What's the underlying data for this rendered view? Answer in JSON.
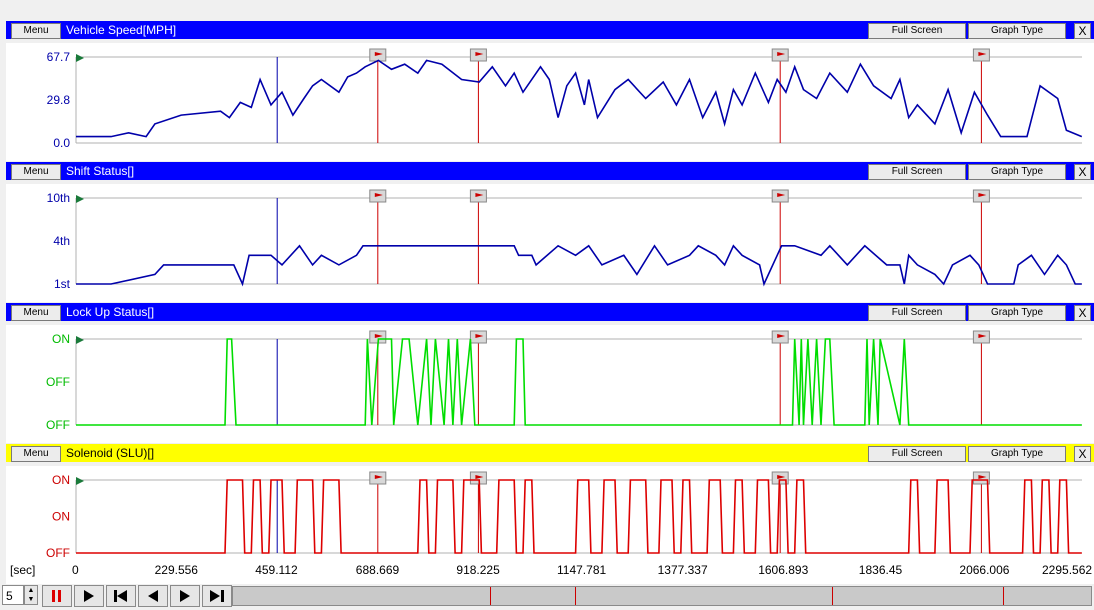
{
  "panels": [
    {
      "menu_label": "Menu",
      "title": "Vehicle Speed[MPH]",
      "full_screen_label": "Full Screen",
      "graph_type_label": "Graph Type",
      "close_label": "X",
      "bar_color": "#0000ff",
      "title_color": "#ffffff",
      "y_labels": [
        "67.7",
        "29.8",
        "0.0"
      ]
    },
    {
      "menu_label": "Menu",
      "title": "Shift Status[]",
      "full_screen_label": "Full Screen",
      "graph_type_label": "Graph Type",
      "close_label": "X",
      "bar_color": "#0000ff",
      "title_color": "#ffffff",
      "y_labels": [
        "10th",
        "4th",
        "1st"
      ]
    },
    {
      "menu_label": "Menu",
      "title": "Lock Up Status[]",
      "full_screen_label": "Full Screen",
      "graph_type_label": "Graph Type",
      "close_label": "X",
      "bar_color": "#0000ff",
      "title_color": "#ffffff",
      "y_labels": [
        "ON",
        "OFF",
        "OFF"
      ]
    },
    {
      "menu_label": "Menu",
      "title": "Solenoid (SLU)[]",
      "full_screen_label": "Full Screen",
      "graph_type_label": "Graph Type",
      "close_label": "X",
      "bar_color": "#ffff00",
      "title_color": "#000000",
      "y_labels": [
        "ON",
        "ON",
        "OFF"
      ]
    }
  ],
  "x_axis": {
    "unit_label": "[sec]",
    "ticks": [
      "0",
      "229.556",
      "459.112",
      "688.669",
      "918.225",
      "1147.781",
      "1377.337",
      "1606.893",
      "1836.45",
      "2066.006",
      "2295.562"
    ]
  },
  "controls": {
    "step_value": "5",
    "buttons": [
      "stop-icon",
      "play-icon",
      "skip-start-icon",
      "step-back-icon",
      "step-forward-icon",
      "skip-end-icon"
    ]
  },
  "chart_data": [
    {
      "type": "line",
      "title": "Vehicle Speed[MPH]",
      "color": "#0000aa",
      "xlim": [
        0,
        2295.562
      ],
      "ylim": [
        0,
        67.7
      ],
      "x": [
        0,
        80,
        120,
        160,
        180,
        240,
        330,
        350,
        375,
        400,
        420,
        445,
        470,
        495,
        520,
        540,
        560,
        600,
        620,
        640,
        660,
        690,
        720,
        750,
        780,
        800,
        835,
        880,
        920,
        950,
        980,
        1000,
        1020,
        1060,
        1080,
        1100,
        1120,
        1140,
        1160,
        1170,
        1190,
        1230,
        1260,
        1300,
        1340,
        1370,
        1400,
        1430,
        1460,
        1480,
        1500,
        1520,
        1550,
        1580,
        1600,
        1620,
        1640,
        1660,
        1690,
        1720,
        1760,
        1790,
        1820,
        1860,
        1880,
        1900,
        1920,
        1960,
        1990,
        2020,
        2050,
        2080,
        2110,
        2140,
        2170,
        2200,
        2240,
        2260,
        2295
      ],
      "y": [
        5,
        5,
        8,
        5,
        15,
        22,
        25,
        20,
        32,
        28,
        50,
        30,
        40,
        22,
        35,
        45,
        50,
        40,
        52,
        55,
        60,
        65,
        58,
        62,
        55,
        65,
        62,
        50,
        48,
        60,
        45,
        55,
        40,
        60,
        50,
        20,
        45,
        55,
        30,
        50,
        20,
        42,
        50,
        35,
        48,
        30,
        50,
        20,
        40,
        15,
        42,
        30,
        55,
        32,
        50,
        40,
        60,
        42,
        35,
        55,
        40,
        62,
        45,
        35,
        50,
        20,
        30,
        15,
        42,
        8,
        40,
        22,
        5,
        5,
        5,
        45,
        35,
        10,
        5
      ]
    },
    {
      "type": "line",
      "title": "Shift Status[]",
      "color": "#0000aa",
      "xlim": [
        0,
        2295.562
      ],
      "ylim": [
        1,
        10
      ],
      "x": [
        0,
        80,
        180,
        200,
        360,
        380,
        395,
        445,
        470,
        510,
        540,
        560,
        600,
        640,
        655,
        690,
        780,
        1000,
        1010,
        1040,
        1050,
        1100,
        1140,
        1170,
        1200,
        1250,
        1280,
        1320,
        1350,
        1400,
        1420,
        1460,
        1480,
        1500,
        1520,
        1560,
        1570,
        1600,
        1610,
        1620,
        1640,
        1700,
        1720,
        1740,
        1760,
        1800,
        1850,
        1880,
        1890,
        1900,
        1920,
        1960,
        1980,
        2000,
        2040,
        2060,
        2080,
        2120,
        2140,
        2150,
        2180,
        2210,
        2240,
        2260,
        2280,
        2295
      ],
      "y": [
        1,
        1,
        2,
        3,
        3,
        1,
        4,
        4,
        3,
        5,
        3,
        4,
        3,
        4,
        5,
        5,
        5,
        5,
        4,
        4,
        3,
        5,
        4,
        5,
        3,
        4,
        2,
        5,
        3,
        4,
        5,
        4,
        3,
        5,
        4,
        3,
        1,
        4,
        5,
        5,
        5,
        4,
        5,
        4,
        3,
        5,
        3,
        3,
        1,
        4,
        3,
        2,
        1,
        3,
        4,
        3,
        1,
        1,
        1,
        3,
        4,
        2,
        4,
        3,
        1,
        1
      ]
    },
    {
      "type": "line",
      "title": "Lock Up Status[]",
      "color": "#00dd00",
      "xlim": [
        0,
        2295.562
      ],
      "ylim": [
        0,
        1
      ],
      "x": [
        0,
        340,
        345,
        355,
        365,
        375,
        660,
        665,
        675,
        690,
        700,
        720,
        725,
        745,
        760,
        780,
        800,
        810,
        820,
        840,
        850,
        860,
        870,
        880,
        900,
        910,
        1000,
        1005,
        1020,
        1025,
        1030,
        1635,
        1640,
        1650,
        1655,
        1660,
        1670,
        1680,
        1690,
        1700,
        1710,
        1720,
        1730,
        1800,
        1805,
        1810,
        1820,
        1830,
        1835,
        1880,
        1890,
        1900,
        1905,
        2295
      ],
      "y": [
        0,
        0,
        1,
        1,
        0,
        0,
        0,
        1,
        0,
        1,
        1,
        1,
        0,
        1,
        1,
        0,
        1,
        0,
        1,
        0,
        1,
        0,
        1,
        0,
        1,
        0,
        0,
        1,
        1,
        0,
        0,
        0,
        1,
        0,
        1,
        0,
        1,
        0,
        1,
        0,
        1,
        1,
        0,
        0,
        1,
        0,
        1,
        0,
        1,
        0,
        1,
        0,
        0,
        0
      ]
    },
    {
      "type": "line",
      "title": "Solenoid (SLU)[]",
      "color": "#dd0000",
      "xlim": [
        0,
        2295.562
      ],
      "ylim": [
        0,
        1
      ],
      "x": [
        0,
        340,
        345,
        380,
        385,
        400,
        405,
        420,
        425,
        440,
        445,
        470,
        475,
        500,
        505,
        540,
        545,
        560,
        565,
        600,
        605,
        780,
        785,
        800,
        805,
        820,
        825,
        860,
        865,
        880,
        885,
        920,
        925,
        960,
        965,
        1000,
        1005,
        1020,
        1025,
        1040,
        1045,
        1140,
        1145,
        1170,
        1175,
        1200,
        1205,
        1230,
        1235,
        1260,
        1265,
        1300,
        1305,
        1330,
        1335,
        1360,
        1365,
        1380,
        1385,
        1400,
        1405,
        1440,
        1445,
        1470,
        1475,
        1500,
        1505,
        1520,
        1525,
        1550,
        1555,
        1580,
        1585,
        1600,
        1605,
        1620,
        1625,
        1640,
        1645,
        1660,
        1665,
        1900,
        1905,
        1920,
        1925,
        1960,
        1965,
        1990,
        1995,
        2040,
        2045,
        2080,
        2085,
        2160,
        2165,
        2180,
        2185,
        2200,
        2205,
        2220,
        2225,
        2240,
        2245,
        2260,
        2265,
        2295
      ],
      "y": [
        0,
        0,
        1,
        1,
        0,
        0,
        1,
        1,
        0,
        0,
        1,
        1,
        0,
        0,
        1,
        1,
        0,
        0,
        1,
        1,
        0,
        0,
        1,
        1,
        0,
        0,
        1,
        1,
        0,
        0,
        1,
        1,
        0,
        0,
        1,
        1,
        0,
        0,
        1,
        1,
        0,
        0,
        1,
        1,
        0,
        0,
        1,
        1,
        0,
        0,
        1,
        1,
        0,
        0,
        1,
        1,
        0,
        0,
        1,
        1,
        0,
        0,
        1,
        1,
        0,
        0,
        1,
        1,
        0,
        0,
        1,
        1,
        0,
        0,
        1,
        1,
        0,
        0,
        1,
        1,
        0,
        0,
        1,
        1,
        0,
        0,
        1,
        1,
        0,
        0,
        1,
        1,
        0,
        0,
        1,
        1,
        0,
        0,
        1,
        1,
        0,
        0,
        1,
        1,
        0,
        0
      ]
    }
  ],
  "markers": {
    "cursor_x": 459.112,
    "event_x": [
      688.669,
      918.225,
      1606.893,
      2066.006
    ],
    "cursor_color": "#0000aa",
    "event_color": "#cc0000"
  }
}
